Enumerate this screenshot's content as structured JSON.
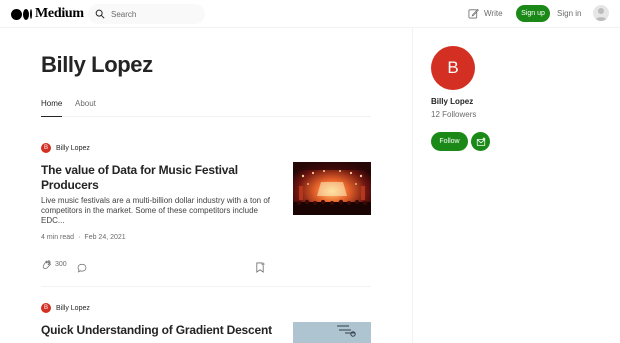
{
  "header": {
    "logo_text": "Medium",
    "search_placeholder": "Search",
    "write_label": "Write",
    "signup_label": "Sign up",
    "signin_label": "Sign in"
  },
  "profile": {
    "name": "Billy Lopez",
    "tabs": [
      {
        "label": "Home",
        "active": true
      },
      {
        "label": "About",
        "active": false
      }
    ]
  },
  "articles": [
    {
      "author": "Billy Lopez",
      "author_initial": "B",
      "title": "The value of Data for Music Festival Producers",
      "snippet": "Live music festivals are a multi-billion dollar industry with a ton of competitors in the market. Some of these competitors include EDC...",
      "read_time": "4 min read",
      "separator": "·",
      "date": "Feb 24, 2021",
      "claps": "300"
    },
    {
      "author": "Billy Lopez",
      "author_initial": "B",
      "title": "Quick Understanding of Gradient Descent"
    }
  ],
  "sidebar": {
    "avatar_initial": "B",
    "name": "Billy Lopez",
    "followers": "12 Followers",
    "follow_label": "Follow"
  },
  "colors": {
    "brand_green": "#1a8917",
    "avatar_red": "#d32f23",
    "text_primary": "#242424",
    "text_secondary": "#6b6b6b"
  },
  "icons": [
    "medium-logo-icon",
    "search-icon",
    "write-icon",
    "user-avatar-icon",
    "clap-icon",
    "comment-icon",
    "bookmark-icon",
    "subscribe-mail-icon"
  ]
}
